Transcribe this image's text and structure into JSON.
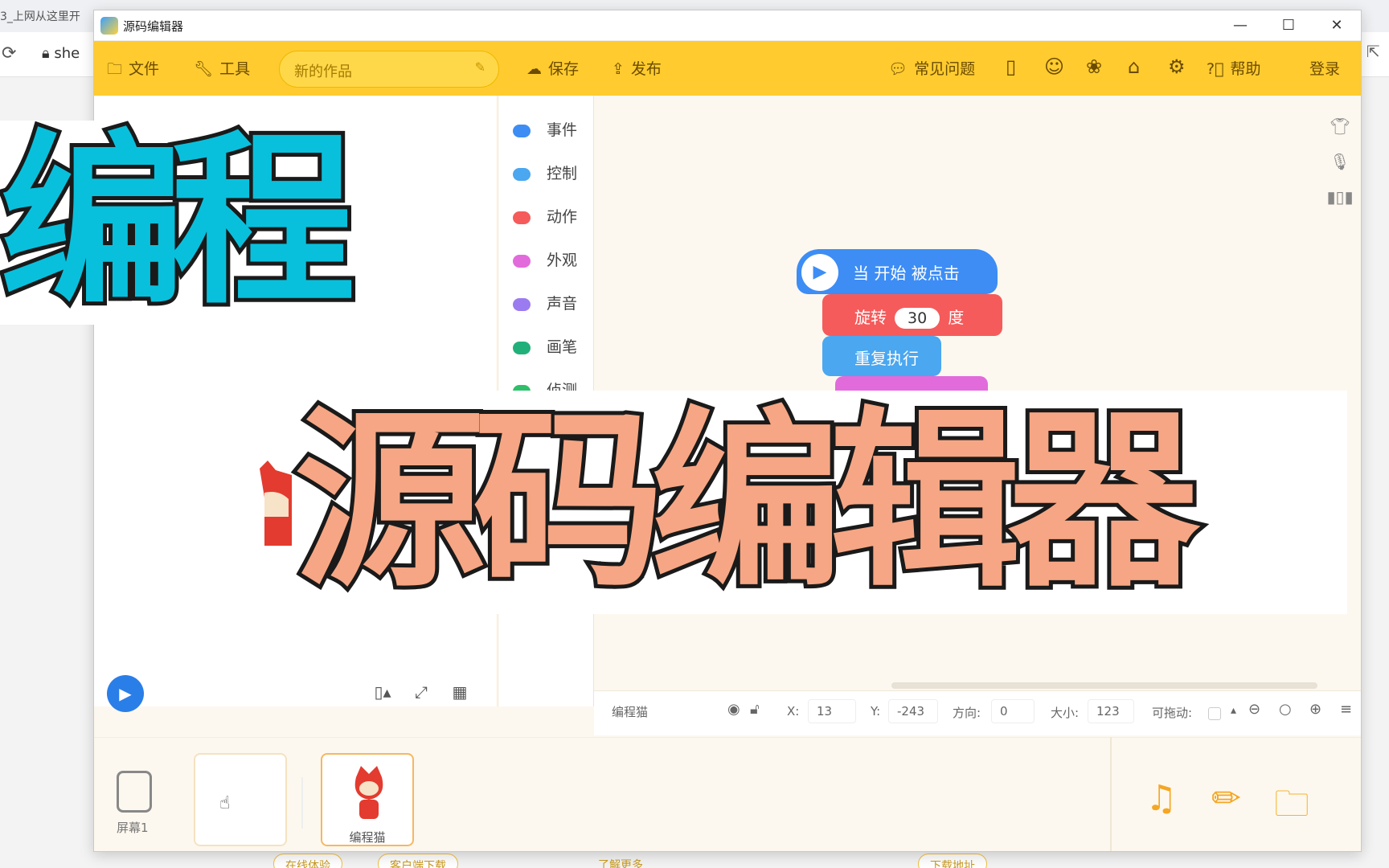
{
  "browser": {
    "tab_text": "3_上网从这里开",
    "url_fragment": "she",
    "footer_links": [
      "在线体验",
      "客户端下载",
      "了解更多",
      "下载地址"
    ]
  },
  "window": {
    "title": "源码编辑器",
    "controls": {
      "minimize": "—",
      "maximize": "☐",
      "close": "✕"
    }
  },
  "toolbar": {
    "file": "文件",
    "tools": "工具",
    "project_name": "新的作品",
    "save": "保存",
    "publish": "发布",
    "faq": "常见问题",
    "help": "帮助",
    "login": "登录",
    "accent": "#ffcb2f"
  },
  "categories": [
    {
      "label": "事件",
      "color": "#3d8df5"
    },
    {
      "label": "控制",
      "color": "#4aa7f0"
    },
    {
      "label": "动作",
      "color": "#f55b5b"
    },
    {
      "label": "外观",
      "color": "#e26bdc"
    },
    {
      "label": "声音",
      "color": "#9b7bf0"
    },
    {
      "label": "画笔",
      "color": "#22b07a"
    },
    {
      "label": "侦测",
      "color": "#2fbf6a"
    }
  ],
  "blocks": {
    "start": "当 开始 被点击",
    "rotate_label": "旋转",
    "rotate_value": "30",
    "rotate_unit": "度",
    "repeat": "重复执行"
  },
  "props": {
    "sprite_name": "编程猫",
    "x_label": "X:",
    "x_value": "13",
    "y_label": "Y:",
    "y_value": "-243",
    "dir_label": "方向:",
    "dir_value": "0",
    "size_label": "大小:",
    "size_value": "123",
    "drag_label": "可拖动:"
  },
  "bottom": {
    "screen_label": "屏幕1",
    "sprite_card_label": "编程猫"
  },
  "overlay": {
    "title_top": "编程",
    "title_bottom": "源码编辑器"
  }
}
